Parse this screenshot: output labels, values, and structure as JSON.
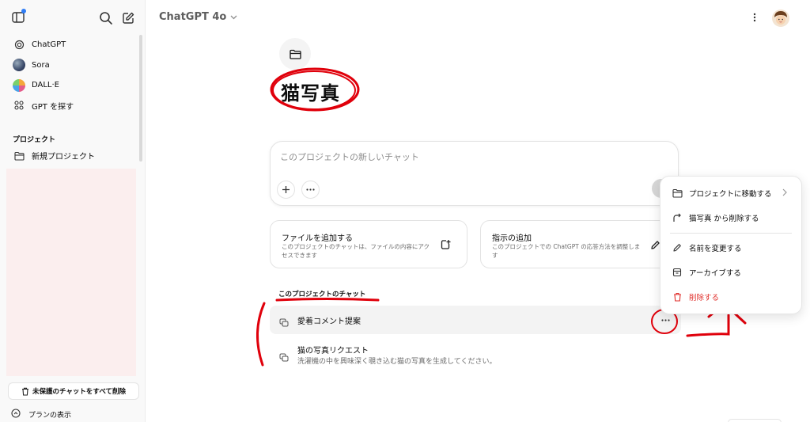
{
  "sidebar": {
    "items": [
      {
        "label": "ChatGPT",
        "icon": "openai-icon"
      },
      {
        "label": "Sora",
        "icon": "sora-avatar"
      },
      {
        "label": "DALL·E",
        "icon": "dalle-avatar"
      },
      {
        "label": "GPT を探す",
        "icon": "grid-icon"
      }
    ],
    "projects_title": "プロジェクト",
    "new_project_label": "新規プロジェクト",
    "delete_unsaved_label": "未保護のチャットをすべて削除",
    "plan_label": "プランの表示"
  },
  "header": {
    "model": "ChatGPT 4o"
  },
  "project": {
    "title": "猫写真",
    "composer_placeholder": "このプロジェクトの新しいチャット",
    "cards": [
      {
        "title": "ファイルを追加する",
        "desc": "このプロジェクトのチャットは、ファイルの内容にアクセスできます"
      },
      {
        "title": "指示の追加",
        "desc": "このプロジェクトでの ChatGPT の応答方法を調整します"
      }
    ],
    "chats_heading": "このプロジェクトのチャット",
    "chats": [
      {
        "title": "愛着コメント提案",
        "subtitle": ""
      },
      {
        "title": "猫の写真リクエスト",
        "subtitle": "洗濯機の中を興味深く覗き込む猫の写真を生成してください。"
      }
    ]
  },
  "context_menu": {
    "items": [
      {
        "label": "プロジェクトに移動する",
        "icon": "folder-icon",
        "danger": false
      },
      {
        "label": "猫写真 から削除する",
        "icon": "redo-arrow-icon",
        "danger": false
      },
      {
        "label": "名前を変更する",
        "icon": "pencil-icon",
        "danger": false
      },
      {
        "label": "アーカイブする",
        "icon": "archive-icon",
        "danger": false
      },
      {
        "label": "削除する",
        "icon": "trash-icon",
        "danger": true
      }
    ]
  },
  "colors": {
    "accent_danger": "#e02e2a",
    "annotation_red": "#e0000b",
    "sidebar_bg": "#f9f9f9"
  }
}
